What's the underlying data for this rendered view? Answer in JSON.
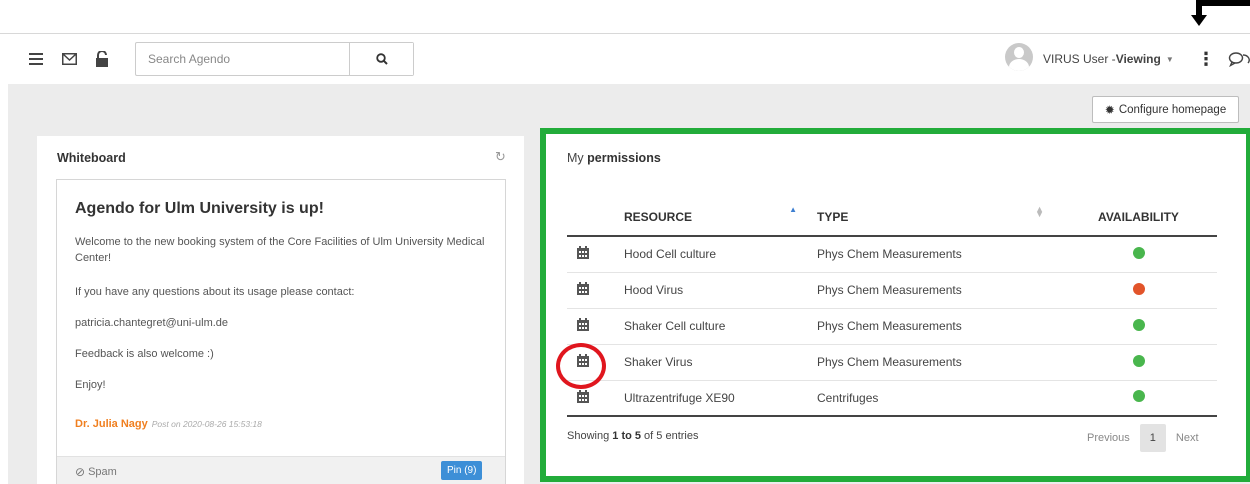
{
  "topbar": {
    "search_placeholder": "Search Agendo",
    "user_name": "VIRUS User - ",
    "user_role": "Viewing",
    "icons": [
      "menu-icon",
      "mail-icon",
      "unlock-icon",
      "search-icon",
      "user-avatar",
      "more-vertical-icon",
      "chat-icon"
    ]
  },
  "configure_button": "Configure homepage",
  "whiteboard": {
    "title": "Whiteboard",
    "post": {
      "title": "Agendo for Ulm University is up!",
      "paragraphs": [
        "Welcome to the new booking system of the Core Facilities of Ulm University Medical Center!",
        "If you have any questions about its usage please contact:",
        "patricia.chantegret@uni-ulm.de",
        "Feedback is also welcome :)",
        "Enjoy!"
      ],
      "author": "Dr. Julia Nagy",
      "date": "Post on 2020-08-26 15:53:18",
      "spam_label": "Spam",
      "pin_label": "Pin (9)"
    }
  },
  "permissions": {
    "title_prefix": "My ",
    "title_bold": "permissions",
    "columns": [
      "Resource",
      "Type",
      "Availability"
    ],
    "rows": [
      {
        "resource": "Hood Cell culture",
        "type": "Phys Chem Measurements",
        "availability": "available",
        "color": "#49b64d"
      },
      {
        "resource": "Hood Virus",
        "type": "Phys Chem Measurements",
        "availability": "unavailable",
        "color": "#e2542a"
      },
      {
        "resource": "Shaker Cell culture",
        "type": "Phys Chem Measurements",
        "availability": "available",
        "color": "#49b64d"
      },
      {
        "resource": "Shaker Virus",
        "type": "Phys Chem Measurements",
        "availability": "available",
        "color": "#49b64d"
      },
      {
        "resource": "Ultrazentrifuge XE90",
        "type": "Centrifuges",
        "availability": "available",
        "color": "#49b64d"
      }
    ],
    "showing_prefix": "Showing ",
    "showing_range": "1 to 5",
    "showing_suffix": " of 5 entries",
    "pager": {
      "previous": "Previous",
      "current": "1",
      "next": "Next"
    }
  },
  "colors": {
    "highlight_box": "#22ac3a",
    "highlight_circle": "#e0161e",
    "author_name": "#f07f1f",
    "pin_badge": "#3d8fd7"
  }
}
